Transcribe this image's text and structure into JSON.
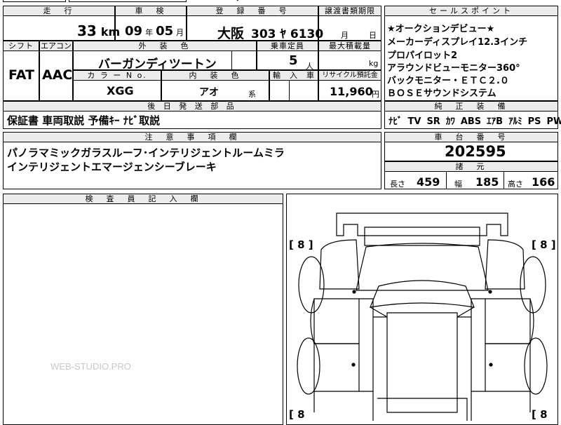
{
  "top_fragment": "ｰﾝ",
  "headers": {
    "mileage": "走　行",
    "inspection": "車　検",
    "registration": "登　録　番　号",
    "transfer_deadline": "譲渡書類期限",
    "selling_points": "セールスポイント",
    "shift": "シフト",
    "aircon": "エアコン",
    "exterior_color": "外　装　色",
    "capacity": "乗車定員",
    "max_load": "最大積載量",
    "color_no": "カ ラ ー N o.",
    "interior_color": "内　装　色",
    "import": "輸　入　車",
    "recycle": "リサイクル預託金",
    "aftermarket": "後 日 発 送 部 品",
    "genuine_equipment": "純　正　装　備",
    "notes": "注　意　事　項　欄",
    "chassis_no": "車　台　番　号",
    "specs": "諸　元",
    "inspector_notes": "検　査　員　記　入　欄"
  },
  "mileage": {
    "value": "33",
    "unit": "km"
  },
  "inspection": {
    "year": "09",
    "year_unit": "年",
    "month": "05",
    "month_unit": "月"
  },
  "registration": {
    "region": "大阪",
    "number": "303 ﾔ 6130"
  },
  "transfer_deadline": {
    "month_unit": "月",
    "day_unit": "日"
  },
  "selling_points": [
    "★オークションデビュー★",
    "メーカーディスプレイ12.3インチ",
    "プロパイロット2",
    "アラウンドビューモニター360°",
    "バックモニター・ＥＴＣ２.０",
    "ＢＯＳＥサウンドシステム"
  ],
  "shift": "FAT",
  "aircon": "AAC",
  "exterior_color": "バーガンディツートン",
  "capacity": {
    "value": "5",
    "unit": "人"
  },
  "max_load": {
    "unit": "kg"
  },
  "color_no": "XGG",
  "interior_color": {
    "value": "アオ",
    "suffix": "系"
  },
  "recycle": {
    "value": "11,960",
    "unit": "円"
  },
  "aftermarket_parts": "保証書 車両取説 予備ｷｰ ﾅﾋﾞ取説",
  "genuine_equipment": [
    "ﾅﾋﾞ",
    "TV",
    "SR",
    "ｶﾜ",
    "ABS",
    "ｴｱB",
    "ｱﾙﾐ",
    "PS",
    "PW"
  ],
  "notes": [
    "パノラマミックガラスルーフ･インテリジェントルームミラ",
    "インテリジェントエマージェンシーブレーキ"
  ],
  "chassis_no": "202595",
  "specs": {
    "length_label": "長さ",
    "length": "459",
    "width_label": "幅",
    "width": "185",
    "height_label": "高さ",
    "height": "166"
  },
  "tire_marks": {
    "front_left": "[ 8 ]",
    "front_right": "[ 8 ]",
    "rear_left": "[ 8",
    "rear_right": "[ 8"
  },
  "watermark": "WEB-STUDIO.PRO"
}
